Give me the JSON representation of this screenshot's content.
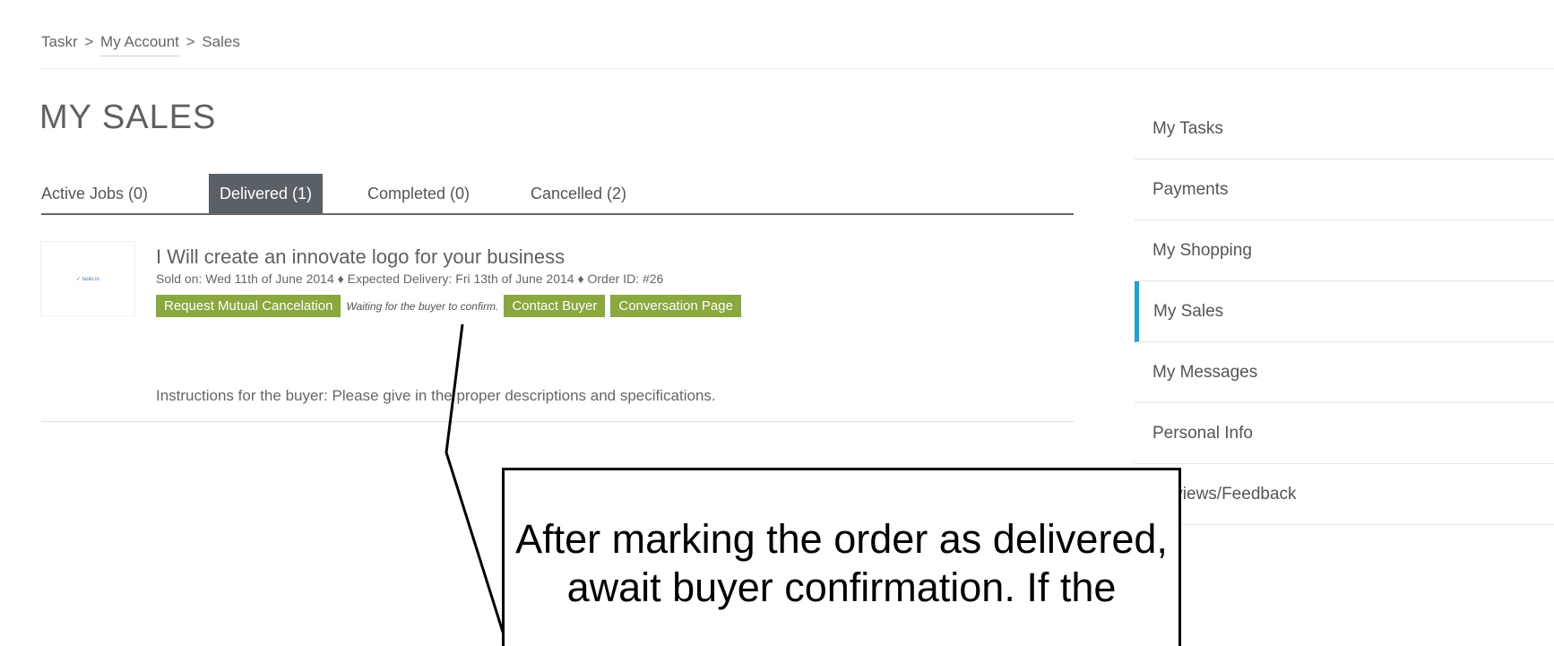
{
  "breadcrumb": {
    "root": "Taskr",
    "separator": ">",
    "account": "My Account",
    "current": "Sales"
  },
  "page_title": "MY SALES",
  "tabs": [
    {
      "label": "Active Jobs (0)",
      "active": false
    },
    {
      "label": "Delivered (1)",
      "active": true
    },
    {
      "label": "Completed (0)",
      "active": false
    },
    {
      "label": "Cancelled (2)",
      "active": false
    }
  ],
  "job": {
    "thumbnail_text": "✓ taskr.in",
    "title": "I Will create an innovate logo for your business",
    "meta": "Sold on: Wed 11th of June 2014 ♦ Expected Delivery: Fri 13th of June 2014 ♦ Order ID: #26",
    "request_cancel_label": "Request Mutual Cancelation",
    "waiting_text": "Waiting for the buyer to confirm.",
    "contact_buyer_label": "Contact Buyer",
    "conversation_label": "Conversation Page",
    "instructions": "Instructions for the buyer: Please give in the proper descriptions and specifications."
  },
  "sidebar": {
    "items": [
      {
        "label": "My Tasks",
        "active": false
      },
      {
        "label": "Payments",
        "active": false
      },
      {
        "label": "My Shopping",
        "active": false
      },
      {
        "label": "My Sales",
        "active": true
      },
      {
        "label": "My Messages",
        "active": false
      },
      {
        "label": "Personal Info",
        "active": false
      },
      {
        "label": "Reviews/Feedback",
        "active": false
      }
    ]
  },
  "callout": {
    "line1": "After marking the order as delivered,",
    "line2": "await buyer confirmation. If the"
  },
  "colors": {
    "action_green": "#8aa83e",
    "active_tab_bg": "#5a6166",
    "sidebar_active_accent": "#1ba3d9"
  }
}
